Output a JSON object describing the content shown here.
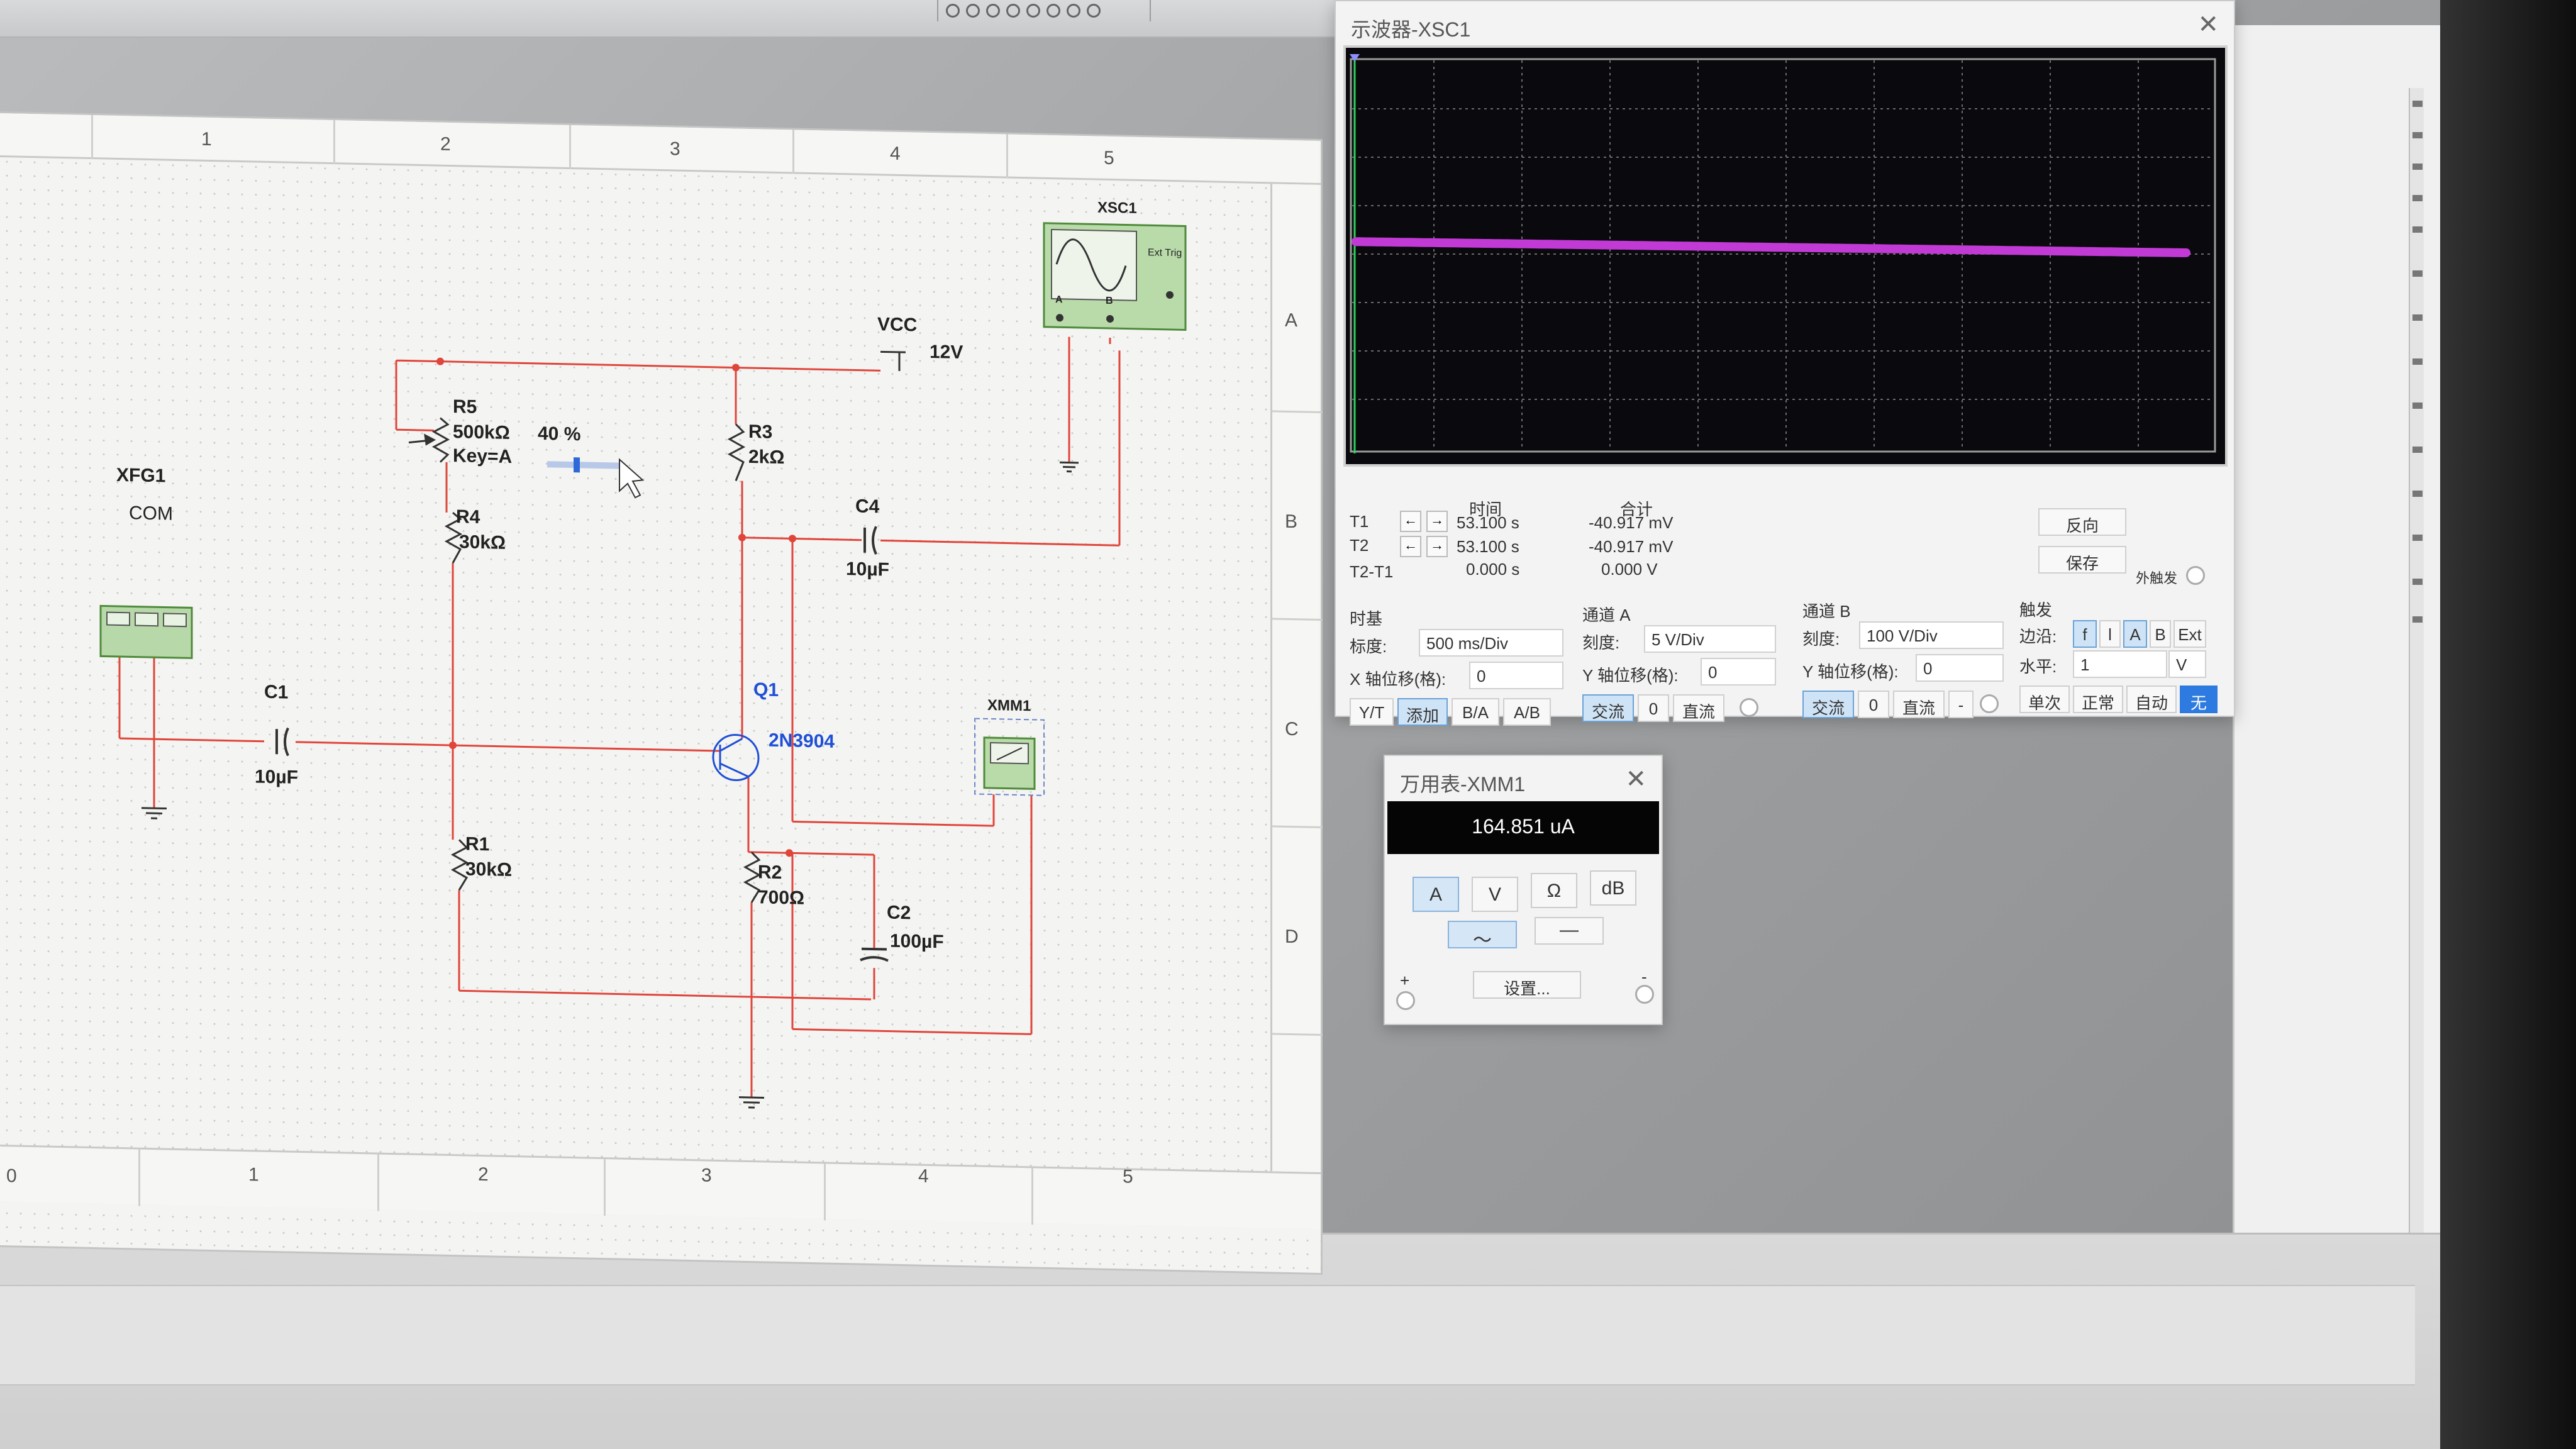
{
  "schematic": {
    "ruler_top": [
      "1",
      "2",
      "3",
      "4",
      "5"
    ],
    "ruler_bottom": [
      "0",
      "1",
      "2",
      "3",
      "4",
      "5"
    ],
    "ruler_right": [
      "A",
      "B",
      "C",
      "D"
    ],
    "components": {
      "xfg1": {
        "ref": "XFG1",
        "com": "COM"
      },
      "xsc1": {
        "ref": "XSC1",
        "ext_trig": "Ext Trig",
        "ch_a": "A",
        "ch_b": "B"
      },
      "vcc": {
        "ref": "VCC",
        "value": "12V"
      },
      "r5": {
        "ref": "R5",
        "value": "500kΩ",
        "key": "Key=A",
        "percent": "40 %"
      },
      "r4": {
        "ref": "R4",
        "value": "30kΩ"
      },
      "r1": {
        "ref": "R1",
        "value": "30kΩ"
      },
      "r3": {
        "ref": "R3",
        "value": "2kΩ"
      },
      "r2": {
        "ref": "R2",
        "value": "700Ω"
      },
      "c1": {
        "ref": "C1",
        "value": "10µF"
      },
      "c4": {
        "ref": "C4",
        "value": "10µF"
      },
      "c2": {
        "ref": "C2",
        "value": "100µF"
      },
      "q1": {
        "ref": "Q1",
        "model": "2N3904"
      },
      "xmm1": {
        "ref": "XMM1"
      }
    }
  },
  "oscilloscope": {
    "title": "示波器-XSC1",
    "close": "✕",
    "cursor_header": {
      "time": "时间",
      "sum": "合计"
    },
    "rows": [
      {
        "label": "T1",
        "time": "53.100 s",
        "value": "-40.917 mV"
      },
      {
        "label": "T2",
        "time": "53.100 s",
        "value": "-40.917 mV"
      },
      {
        "label": "T2-T1",
        "time": "0.000 s",
        "value": "0.000 V"
      }
    ],
    "buttons": {
      "reverse": "反向",
      "save": "保存",
      "ext_trigger": "外触发"
    },
    "timebase": {
      "title": "时基",
      "scale_label": "标度:",
      "scale_value": "500 ms/Div",
      "xpos_label": "X 轴位移(格):",
      "xpos_value": "0",
      "modes": [
        "Y/T",
        "添加",
        "B/A",
        "A/B"
      ]
    },
    "channel_a": {
      "title": "通道 A",
      "scale_label": "刻度:",
      "scale_value": "5  V/Div",
      "ypos_label": "Y 轴位移(格):",
      "ypos_value": "0",
      "coupling": [
        "交流",
        "0",
        "直流"
      ]
    },
    "channel_b": {
      "title": "通道 B",
      "scale_label": "刻度:",
      "scale_value": "100  V/Div",
      "ypos_label": "Y 轴位移(格):",
      "ypos_value": "0",
      "coupling": [
        "交流",
        "0",
        "直流",
        "-"
      ]
    },
    "trigger": {
      "title": "触发",
      "edge_label": "边沿:",
      "edge_options": [
        "f",
        "l",
        "A",
        "B",
        "Ext"
      ],
      "level_label": "水平:",
      "level_value": "1",
      "level_unit": "V",
      "modes": [
        "单次",
        "正常",
        "自动",
        "无"
      ]
    },
    "trace_color": "#c23ad6"
  },
  "multimeter": {
    "title": "万用表-XMM1",
    "close": "✕",
    "reading": "164.851 uA",
    "modes": [
      "A",
      "V",
      "Ω",
      "dB"
    ],
    "ac_symbol": "～",
    "dc_symbol": "—",
    "settings": "设置...",
    "plus": "+",
    "minus": "-"
  }
}
